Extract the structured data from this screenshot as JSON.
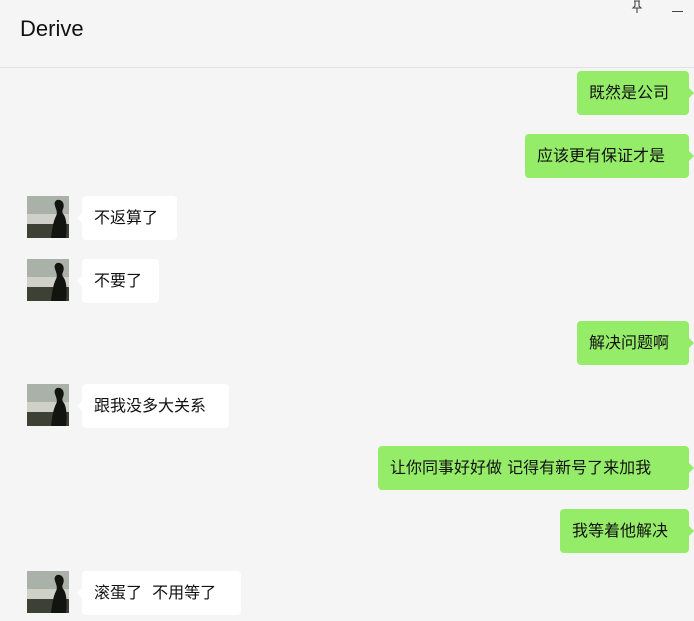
{
  "window": {
    "title": "Derive",
    "pin_icon": "pin-icon",
    "minimize_icon": "minimize-icon"
  },
  "colors": {
    "background": "#f5f5f5",
    "outgoing_bubble": "#95ec69",
    "incoming_bubble": "#ffffff",
    "text": "#111111"
  },
  "messages": [
    {
      "direction": "out",
      "text": "既然是公司"
    },
    {
      "direction": "out",
      "text": "应该更有保证才是"
    },
    {
      "direction": "in",
      "text": "不返算了"
    },
    {
      "direction": "in",
      "text": "不要了"
    },
    {
      "direction": "out",
      "text": "解决问题啊"
    },
    {
      "direction": "in",
      "text": "跟我没多大关系"
    },
    {
      "direction": "out",
      "text": "让你同事好好做 记得有新号了来加我"
    },
    {
      "direction": "out",
      "text": "我等着他解决"
    },
    {
      "direction": "in",
      "text": "滚蛋了  不用等了"
    }
  ]
}
